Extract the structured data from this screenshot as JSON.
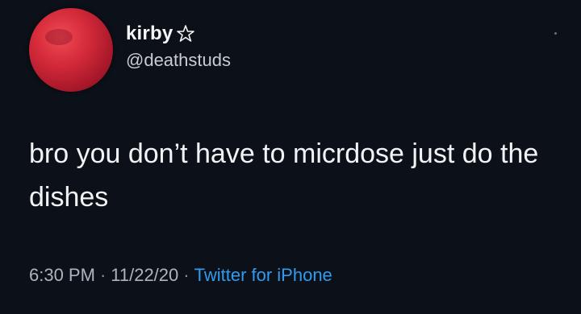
{
  "user": {
    "display_name": "kirby",
    "name_emblem_icon": "pentagram-icon",
    "handle": "@deathstuds",
    "avatar": "red-moon-avatar"
  },
  "tweet": {
    "text": "bro you don’t have to micrdose just do the dishes"
  },
  "meta": {
    "time": "6:30 PM",
    "separator": "·",
    "date": "11/22/20",
    "source": "Twitter for iPhone"
  },
  "colors": {
    "background": "#0c1019",
    "link": "#2f9cf0",
    "avatar": "#d62b3a"
  }
}
